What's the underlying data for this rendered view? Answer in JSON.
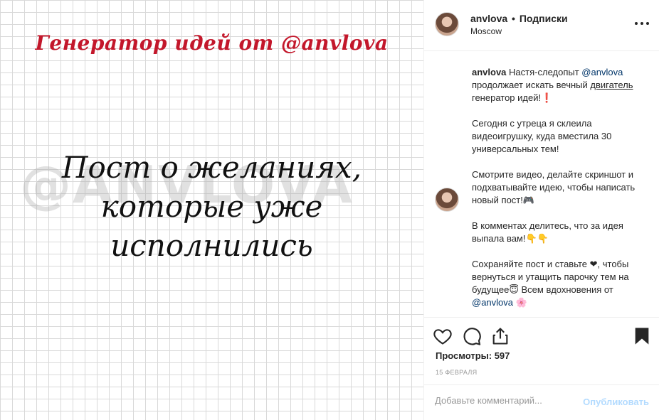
{
  "post_image": {
    "title": "Генератор идей от @anvlova",
    "watermark": "@ANVLOVA",
    "lines": [
      "Пост о желаниях,",
      "которые уже",
      "исполнились"
    ]
  },
  "header": {
    "username": "anvlova",
    "separator": "•",
    "follow_label": "Подписки",
    "location": "Moscow"
  },
  "caption": {
    "username": "anvlova",
    "p1_text": "Настя-следопыт",
    "p1_mention": "@anvlova",
    "p1_text2": "продолжает искать вечный",
    "p1_strike": "двигатель",
    "p1_text3": "генератор идей!❗",
    "p2": "Сегодня с утреца я склеила видеоигрушку, куда вместила 30 универсальных тем!",
    "p3": "Смотрите видео, делайте скриншот и подхватывайте идею, чтобы написать новый пост!🎮",
    "p4": "В комментах делитесь, что за идея выпала вам!👇👇",
    "p5_text": "Сохраняйте пост и ставьте ❤, чтобы вернуться и утащить парочку тем на будущее😇 Всем вдохновения от",
    "p5_mention": "@anvlova",
    "p5_end": "🌸"
  },
  "stats": {
    "views": "Просмотры: 597",
    "date": "15 февраля"
  },
  "comment": {
    "placeholder": "Добавьте комментарий...",
    "publish_label": "Опубликовать"
  },
  "icons": [
    "heart-icon",
    "comment-icon",
    "share-icon",
    "bookmark-icon",
    "more-icon"
  ],
  "colors": {
    "title_red": "#c3172b",
    "mention_blue": "#003569",
    "publish_disabled": "#b3dbff"
  }
}
